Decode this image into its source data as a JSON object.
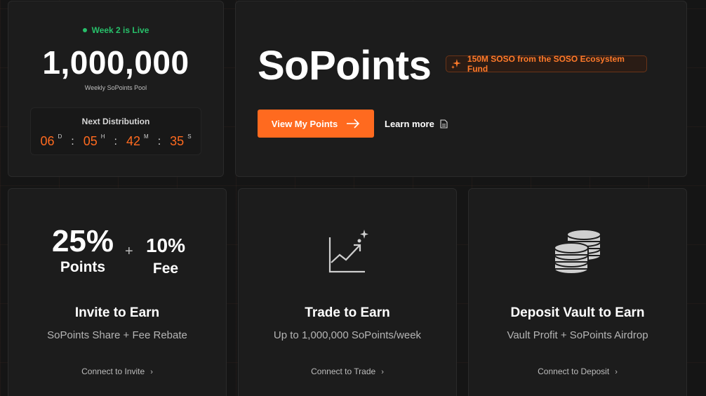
{
  "pool": {
    "live_label": "Week 2 is Live",
    "amount": "1,000,000",
    "amount_label": "Weekly SoPoints Pool",
    "distribution_title": "Next Distribution",
    "countdown": [
      {
        "value": "06",
        "unit": "D"
      },
      {
        "value": "05",
        "unit": "H"
      },
      {
        "value": "42",
        "unit": "M"
      },
      {
        "value": "35",
        "unit": "S"
      }
    ]
  },
  "hero": {
    "title": "SoPoints",
    "fund_badge": "150M SOSO from the SOSO Ecosystem Fund",
    "primary_button": "View My Points",
    "secondary_link": "Learn more"
  },
  "cards": {
    "invite": {
      "stat_main_value": "25%",
      "stat_main_label": "Points",
      "plus": "+",
      "stat_side_value": "10%",
      "stat_side_label": "Fee",
      "title": "Invite to Earn",
      "subtitle": "SoPoints Share + Fee Rebate",
      "cta": "Connect to Invite"
    },
    "trade": {
      "title": "Trade to Earn",
      "subtitle": "Up to 1,000,000 SoPoints/week",
      "cta": "Connect to Trade",
      "icon": "chart-growth-icon"
    },
    "deposit": {
      "title": "Deposit Vault to Earn",
      "subtitle": "Vault Profit + SoPoints Airdrop",
      "cta": "Connect to Deposit",
      "icon": "coins-stack-icon"
    }
  },
  "colors": {
    "accent": "#ff6a1f",
    "live": "#27c06a",
    "card_bg": "#1c1c1c",
    "page_bg": "#151515"
  }
}
